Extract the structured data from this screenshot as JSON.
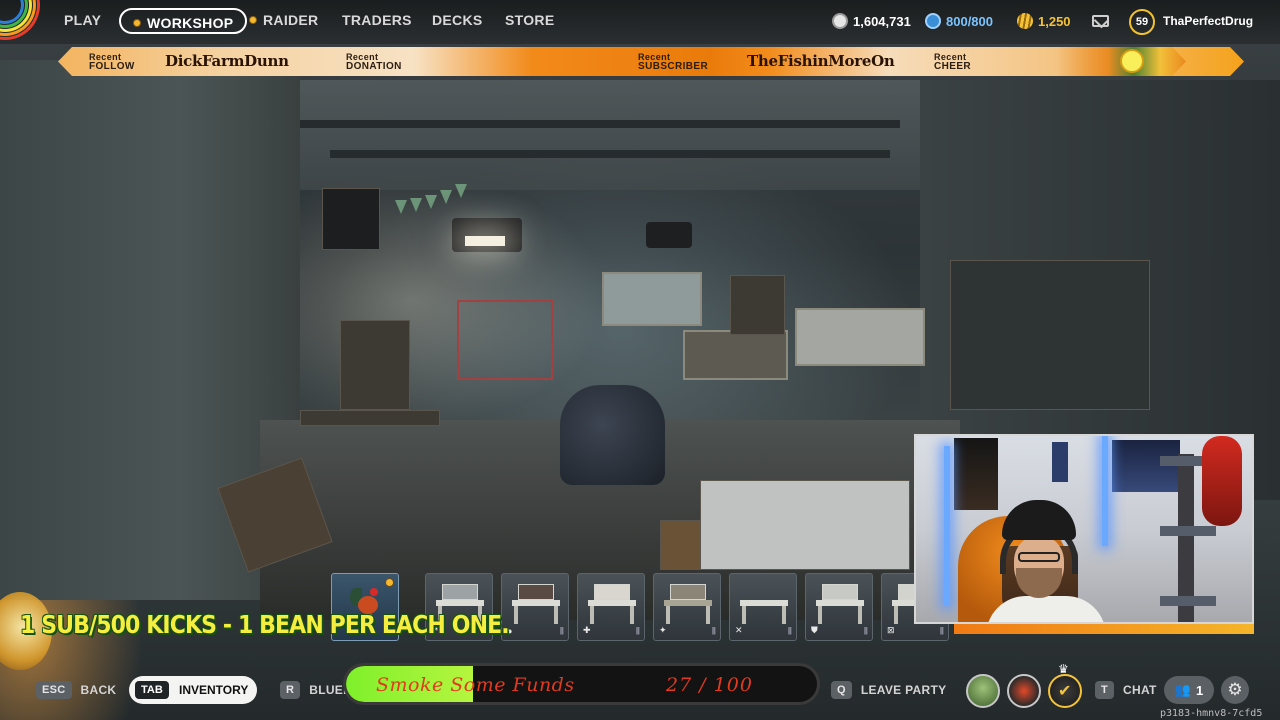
{
  "nav": {
    "items": [
      {
        "label": "PLAY",
        "active": false,
        "dot": false
      },
      {
        "label": "WORKSHOP",
        "active": true,
        "dot": true
      },
      {
        "label": "RAIDER",
        "active": false,
        "dot": true
      },
      {
        "label": "TRADERS",
        "active": false,
        "dot": false
      },
      {
        "label": "DECKS",
        "active": false,
        "dot": false
      },
      {
        "label": "STORE",
        "active": false,
        "dot": false
      }
    ],
    "currencies": {
      "coins": "1,604,731",
      "raider_tokens": "800/800",
      "credits": "1,250"
    },
    "level": "59",
    "username": "ThaPerfectDrug",
    "icons": {
      "coins": "coin-stack-icon",
      "raider_tokens": "token-icon",
      "credits": "credit-icon",
      "mail": "mail-icon"
    }
  },
  "banner": {
    "follow_label_top": "Recent",
    "follow_label_bottom": "FOLLOW",
    "follow_name": "DickFarmDunn",
    "donation_label_top": "Recent",
    "donation_label_bottom": "DONATION",
    "subscriber_label_top": "Recent",
    "subscriber_label_bottom": "SUBSCRIBER",
    "subscriber_name": "TheFishinMoreOn",
    "cheer_label_top": "Recent",
    "cheer_label_bottom": "CHEER"
  },
  "promo_text": "1 SUB/500 KICKS - 1 BEAN PER EACH ONE.",
  "items": [
    {
      "kind": "rooster",
      "icon": "rooster-icon",
      "footer_icon": ""
    },
    {
      "kind": "desk",
      "icon": "workbench-icon",
      "footer_icon": "↗"
    },
    {
      "kind": "desk",
      "icon": "workbench-icon",
      "footer_icon": "●"
    },
    {
      "kind": "desk",
      "icon": "workbench-icon",
      "footer_icon": "✚"
    },
    {
      "kind": "desk",
      "icon": "workbench-icon",
      "footer_icon": "✦"
    },
    {
      "kind": "desk",
      "icon": "workbench-icon",
      "footer_icon": "✕"
    },
    {
      "kind": "desk",
      "icon": "workbench-icon",
      "footer_icon": "⛊"
    },
    {
      "kind": "desk",
      "icon": "workbench-icon",
      "footer_icon": "⊠"
    }
  ],
  "bottom": {
    "esc_key": "ESC",
    "back_label": "BACK",
    "tab_key": "TAB",
    "inventory_label": "INVENTORY",
    "r_key": "R",
    "blueprints_label": "BLUEI",
    "q_key": "Q",
    "leave_party_label": "LEAVE PARTY",
    "t_key": "T",
    "chat_label": "CHAT",
    "party_count": "1",
    "session_id": "p3183-hmnv8-7cfd5"
  },
  "goal": {
    "title": "Smoke Some Funds",
    "count": "27 / 100",
    "current": 27,
    "target": 100,
    "fill_color": "#8df233",
    "text_color": "#e23a1e"
  },
  "colors": {
    "accent_gold": "#f5b82e",
    "banner_orange": "#ea7b0b",
    "promo_yellow": "#f5ee40"
  }
}
